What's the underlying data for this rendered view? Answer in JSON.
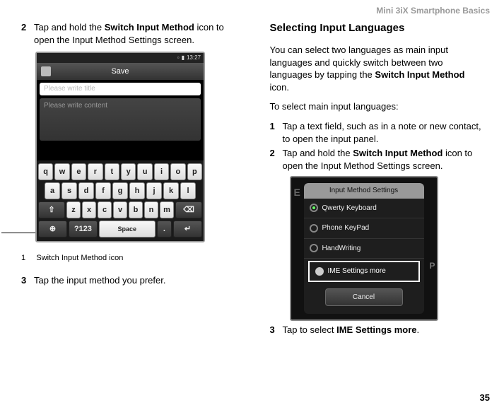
{
  "header": {
    "title": "Mini 3iX Smartphone Basics"
  },
  "page_number": "35",
  "left": {
    "step2": {
      "num": "2",
      "text_a": "Tap and hold the ",
      "bold": "Switch Input Method",
      "text_b": " icon to open the Input Method Settings screen."
    },
    "fig_caption": {
      "num": "1",
      "text": "Switch Input Method icon"
    },
    "step3": {
      "num": "3",
      "text": "Tap the input method you prefer."
    },
    "callout": "1",
    "shot1": {
      "status_time": "13:27",
      "save": "Save",
      "title_ph": "Please write title",
      "content_ph": "Please write content",
      "row1": [
        "q",
        "w",
        "e",
        "r",
        "t",
        "y",
        "u",
        "i",
        "o",
        "p"
      ],
      "row2": [
        "a",
        "s",
        "d",
        "f",
        "g",
        "h",
        "j",
        "k",
        "l"
      ],
      "row3_shift": "⇧",
      "row3": [
        "z",
        "x",
        "c",
        "v",
        "b",
        "n",
        "m"
      ],
      "row3_del": "⌫",
      "row4_lang": "⊕",
      "row4_sym": "?123",
      "row4_space": "Space",
      "row4_dot": ".",
      "row4_enter": "↵"
    }
  },
  "right": {
    "heading": "Selecting Input Languages",
    "para1_a": "You can select two languages as main input languages and quickly switch between two languages by tapping the ",
    "para1_bold": "Switch Input Method",
    "para1_b": " icon.",
    "para2": "To select main input languages:",
    "step1": {
      "num": "1",
      "text": "Tap a text field, such as in a note or new contact, to open the input panel."
    },
    "step2": {
      "num": "2",
      "text_a": "Tap and hold the ",
      "bold": "Switch Input Method",
      "text_b": " icon to open the Input Method Settings screen."
    },
    "step3": {
      "num": "3",
      "text_a": "Tap to select ",
      "bold": "IME Settings more",
      "text_b": "."
    },
    "shot2": {
      "title": "Input Method Settings",
      "opt1": "Qwerty Keyboard",
      "opt2": "Phone KeyPad",
      "opt3": "HandWriting",
      "more": "IME Settings more",
      "cancel": "Cancel"
    }
  }
}
